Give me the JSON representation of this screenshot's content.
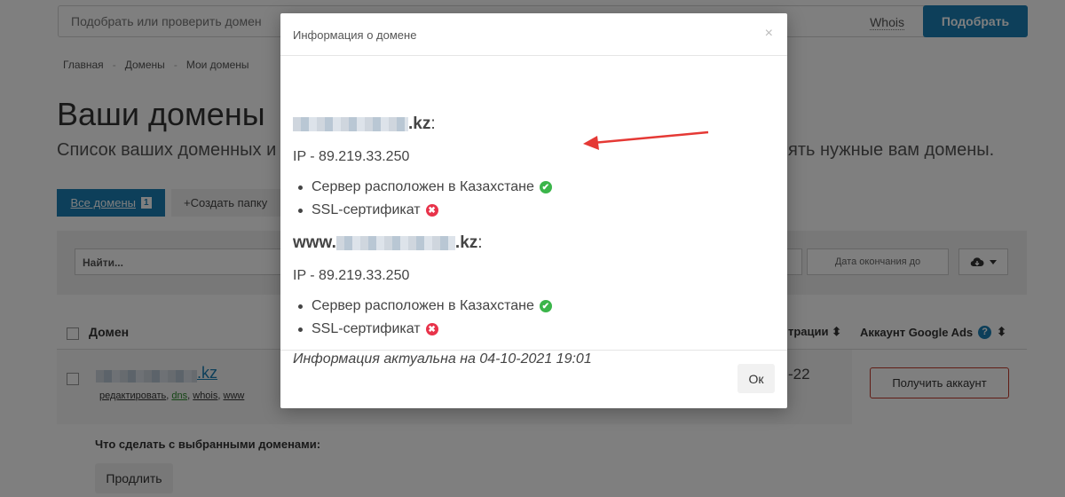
{
  "search": {
    "placeholder": "Подобрать или проверить домен",
    "whois_label": "Whois",
    "pick_label": "Подобрать"
  },
  "breadcrumb": [
    {
      "label": "Главная"
    },
    {
      "label": "Домены"
    },
    {
      "label": "Мои домены"
    }
  ],
  "breadcrumb_sep": "-",
  "page": {
    "title": "Ваши домены",
    "subtitle_left": "Список ваших доменных и",
    "subtitle_right": "ять нужные вам домены."
  },
  "tabs": {
    "all_label": "Все домены",
    "all_count": "1",
    "create_folder_label": "+Создать папку"
  },
  "filters": {
    "search_placeholder": "Найти...",
    "date_end_placeholder": "Дата окончания до"
  },
  "table": {
    "col_domain": "Домен",
    "col_reg": "трации",
    "col_ads": "Аккаунт Google Ads",
    "help": "?",
    "sort": "⬍",
    "row": {
      "tld": ".kz",
      "links": [
        "редактировать",
        "dns",
        "whois",
        "www"
      ],
      "reg_date": "-22",
      "get_account_label": "Получить аккаунт"
    }
  },
  "actions": {
    "title": "Что сделать с выбранными доменами:",
    "renew_label": "Продлить"
  },
  "modal": {
    "title": "Информация о домене",
    "close": "×",
    "domains": [
      {
        "name_prefix": "",
        "name_suffix": ".kz",
        "colon": ":",
        "ip": "IP - 89.219.33.250",
        "items": [
          {
            "text": "Сервер расположен в Казахстане",
            "status": "ok"
          },
          {
            "text": "SSL-сертификат",
            "status": "fail"
          }
        ]
      },
      {
        "name_prefix": "www.",
        "name_suffix": ".kz",
        "colon": ":",
        "ip": "IP - 89.219.33.250",
        "items": [
          {
            "text": "Сервер расположен в Казахстане",
            "status": "ok"
          },
          {
            "text": "SSL-сертификат",
            "status": "fail"
          }
        ]
      }
    ],
    "info_date": "Информация актуальна на 04-10-2021 19:01",
    "ok_label": "Ок",
    "ok_glyph": "✔",
    "fail_glyph": "✖"
  },
  "colors": {
    "accent": "#1a7fb5",
    "ok": "#3bb54a",
    "fail": "#e8334a",
    "arrow": "#e53935"
  }
}
